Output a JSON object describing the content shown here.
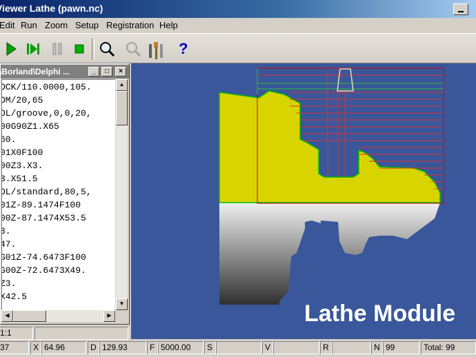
{
  "window": {
    "title": "Viewer Lathe (pawn.nc)"
  },
  "menu": [
    "Edit",
    "Run",
    "Zoom",
    "Setup",
    "Registration",
    "Help"
  ],
  "toolbar": {
    "buttons": [
      "play-icon",
      "step-icon",
      "pause-icon",
      "stop-icon",
      "zoom-icon",
      "zoom-window-icon",
      "tools-icon",
      "help-icon"
    ],
    "help_glyph": "?"
  },
  "editor": {
    "title": "\\Borland\\Delphi ...",
    "lines": [
      "OCK/110.0000,105.",
      "OM/20,65",
      "OL/groove,0,0,20,",
      "00G90Z1.X65",
      "60.",
      "01X0F100",
      "00Z3.X3.",
      "3.X51.5",
      "OL/standard,80,5,",
      "01Z-89.1474F100",
      "00Z-87.1474X53.5",
      "3.",
      "47.",
      "G01Z-74.6473F100",
      "G00Z-72.6473X49.",
      "Z3.",
      "X42.5"
    ],
    "position": "1:1"
  },
  "viewport": {
    "caption": "Lathe Module",
    "background": "#39579a",
    "part_color": "#d8d400"
  },
  "status": {
    "line_value": "37",
    "x_label": "X",
    "x_value": "64.96",
    "d_label": "D",
    "d_value": "129.93",
    "f_label": "F",
    "f_value": "5000.00",
    "s_label": "S",
    "s_value": "",
    "v_label": "V",
    "v_value": "",
    "r_label": "R",
    "r_value": "",
    "n_label": "N",
    "n_value": "99",
    "total": "Total: 99"
  }
}
